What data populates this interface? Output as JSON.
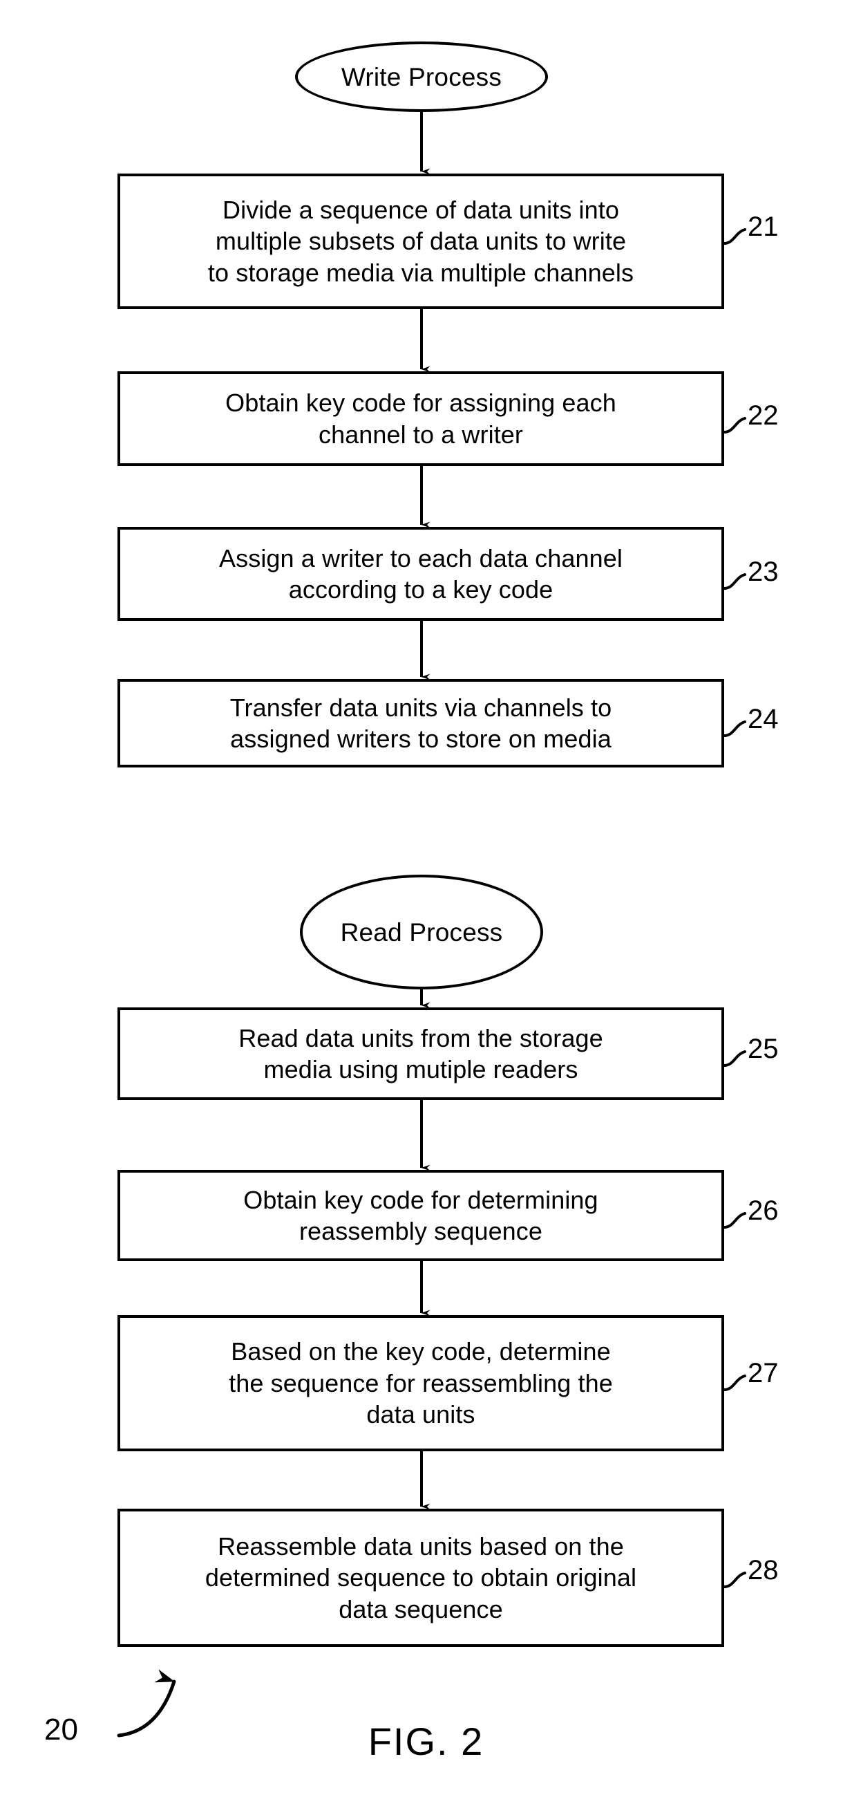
{
  "figure": {
    "caption": "FIG. 2",
    "figure_numeral": "20"
  },
  "write_process": {
    "terminator": {
      "label": "Write Process",
      "shape": "ellipse"
    },
    "steps": [
      {
        "numeral": "21",
        "text": "Divide a sequence of data units into\nmultiple subsets of data units to write\nto storage media via multiple channels"
      },
      {
        "numeral": "22",
        "text": "Obtain key code for assigning each\nchannel to a writer"
      },
      {
        "numeral": "23",
        "text": "Assign a writer to each data channel\naccording to a key code"
      },
      {
        "numeral": "24",
        "text": "Transfer data units via channels to\nassigned writers to store on media"
      }
    ]
  },
  "read_process": {
    "terminator": {
      "label": "Read Process",
      "shape": "ellipse"
    },
    "steps": [
      {
        "numeral": "25",
        "text": "Read data units from the storage\nmedia using mutiple readers"
      },
      {
        "numeral": "26",
        "text": "Obtain key code for determining\nreassembly sequence"
      },
      {
        "numeral": "27",
        "text": "Based on the key code, determine\nthe sequence for reassembling the\ndata units"
      },
      {
        "numeral": "28",
        "text": "Reassemble data units based on the\ndetermined sequence to obtain original\ndata sequence"
      }
    ]
  },
  "style": {
    "line_color": "#000000",
    "background_color": "#ffffff"
  }
}
